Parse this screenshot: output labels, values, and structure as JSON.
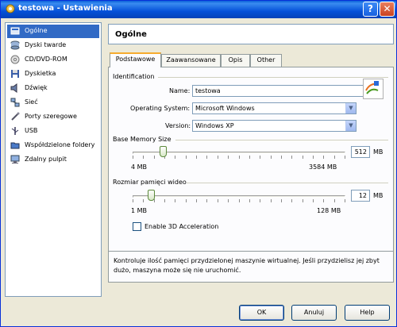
{
  "window": {
    "title": "testowa - Ustawienia"
  },
  "sidebar": {
    "items": [
      {
        "label": "Ogólne",
        "icon": "general-icon",
        "selected": true
      },
      {
        "label": "Dyski twarde",
        "icon": "hard-disk-icon"
      },
      {
        "label": "CD/DVD-ROM",
        "icon": "cd-dvd-icon"
      },
      {
        "label": "Dyskietka",
        "icon": "floppy-icon"
      },
      {
        "label": "Dźwięk",
        "icon": "audio-icon"
      },
      {
        "label": "Sieć",
        "icon": "network-icon"
      },
      {
        "label": "Porty szeregowe",
        "icon": "serial-port-icon"
      },
      {
        "label": "USB",
        "icon": "usb-icon"
      },
      {
        "label": "Współdzielone foldery",
        "icon": "shared-folder-icon"
      },
      {
        "label": "Zdalny pulpit",
        "icon": "remote-desktop-icon"
      }
    ]
  },
  "header": {
    "title": "Ogólne"
  },
  "tabs": [
    "Podstawowe",
    "Zaawansowane",
    "Opis",
    "Other"
  ],
  "identification": {
    "group_label": "Identification",
    "name_label": "Name:",
    "name_value": "testowa",
    "os_label": "Operating System:",
    "os_value": "Microsoft Windows",
    "version_label": "Version:",
    "version_value": "Windows XP"
  },
  "memory": {
    "group_label": "Base Memory Size",
    "value": "512",
    "unit": "MB",
    "min_label": "4 MB",
    "max_label": "3584 MB",
    "level": 0.142
  },
  "video": {
    "group_label": "Rozmiar pamięci wideo",
    "value": "12",
    "unit": "MB",
    "min_label": "1 MB",
    "max_label": "128 MB",
    "level": 0.087,
    "accel_label": "Enable 3D Acceleration",
    "accel_checked": false
  },
  "description": "Kontroluje ilość pamięci przydzielonej maszynie wirtualnej. Jeśli przydzielisz jej zbyt dużo, maszyna może się nie uruchomić.",
  "buttons": {
    "ok": "OK",
    "cancel": "Anuluj",
    "help": "Help"
  },
  "colors": {
    "title_bar": "#0551d9",
    "selection": "#316ac5",
    "tab_highlight": "#f6ab2e"
  }
}
